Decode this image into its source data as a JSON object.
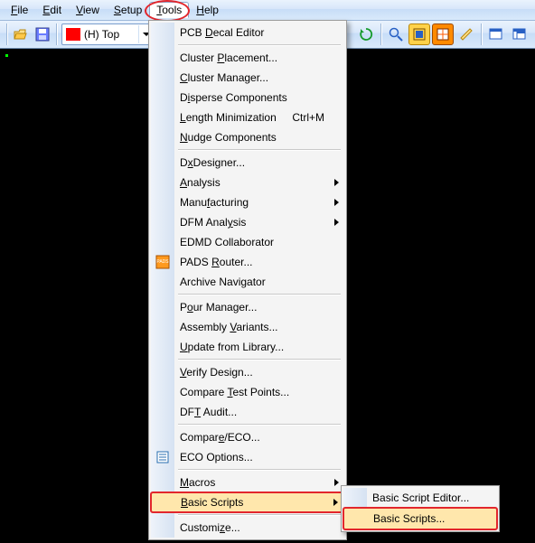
{
  "menubar": [
    "File",
    "Edit",
    "View",
    "Setup",
    "Tools",
    "Help"
  ],
  "layer_label": "(H) Top",
  "menu": {
    "pcb_decal": "PCB Decal Editor",
    "cluster_placement": "Cluster Placement...",
    "cluster_manager": "Cluster Manager...",
    "disperse": "Disperse Components",
    "length_min": "Length Minimization",
    "length_min_sc": "Ctrl+M",
    "nudge": "Nudge Components",
    "dxdesigner": "DxDesigner...",
    "analysis": "Analysis",
    "manufacturing": "Manufacturing",
    "dfm": "DFM Analysis",
    "edmd": "EDMD Collaborator",
    "pads_router": "PADS Router...",
    "archive": "Archive Navigator",
    "pour": "Pour Manager...",
    "assembly": "Assembly Variants...",
    "update_lib": "Update from Library...",
    "verify": "Verify Design...",
    "compare_tp": "Compare Test Points...",
    "dft": "DFT Audit...",
    "compare_eco": "Compare/ECO...",
    "eco_opts": "ECO Options...",
    "macros": "Macros",
    "basic_scripts": "Basic Scripts",
    "customize": "Customize..."
  },
  "submenu": {
    "editor": "Basic Script Editor...",
    "scripts": "Basic Scripts..."
  }
}
